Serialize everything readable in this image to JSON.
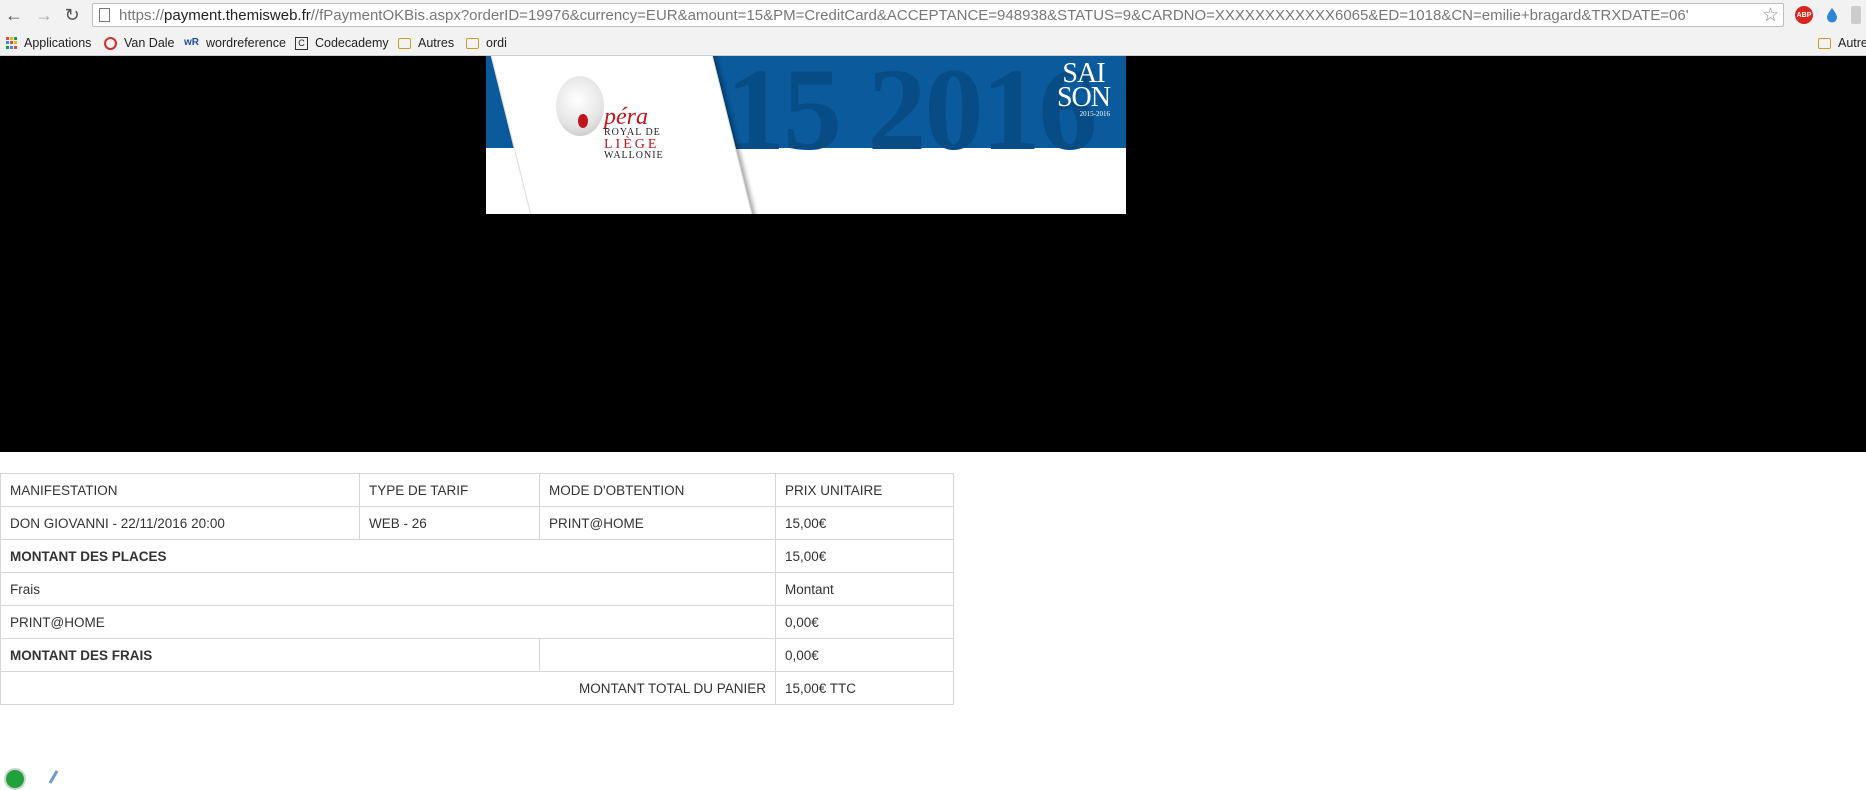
{
  "browser": {
    "url_prefix": "https://",
    "url_host": "payment.themisweb.fr",
    "url_rest": "//fPaymentOKBis.aspx?orderID=19976&currency=EUR&amount=15&PM=CreditCard&ACCEPTANCE=948938&STATUS=9&CARDNO=XXXXXXXXXXXX6065&ED=1018&CN=emilie+bragard&TRXDATE=06'",
    "abp_label": "ABP"
  },
  "bookmarks": {
    "items": [
      "Applications",
      "Van Dale",
      "wordreference",
      "Codecademy",
      "Autres",
      "ordi"
    ],
    "other": "Autre"
  },
  "banner": {
    "year": "15 2016",
    "saison_line1": "SAI",
    "saison_line2": "SON",
    "saison_years": "2015-2016",
    "logo_opera": "péra",
    "logo_royal": "ROYAL DE",
    "logo_liege": "LIÈGE",
    "logo_wallonie": "WALLONIE"
  },
  "table": {
    "header": {
      "manifestation": "MANIFESTATION",
      "type_tarif": "TYPE DE TARIF",
      "mode": "MODE D'OBTENTION",
      "prix": "PRIX UNITAIRE"
    },
    "item": {
      "manifestation": "DON GIOVANNI - 22/11/2016 20:00",
      "type_tarif": "WEB - 26",
      "mode": "PRINT@HOME",
      "prix": "15,00€"
    },
    "montant_places_label": "MONTANT DES PLACES",
    "montant_places_value": "15,00€",
    "frais_label": "Frais",
    "frais_col": "Montant",
    "printhome_label": "PRINT@HOME",
    "printhome_value": "0,00€",
    "montant_frais_label": "MONTANT DES FRAIS",
    "montant_frais_value": "0,00€",
    "total_label": "MONTANT TOTAL DU PANIER",
    "total_value": "15,00€ TTC"
  }
}
